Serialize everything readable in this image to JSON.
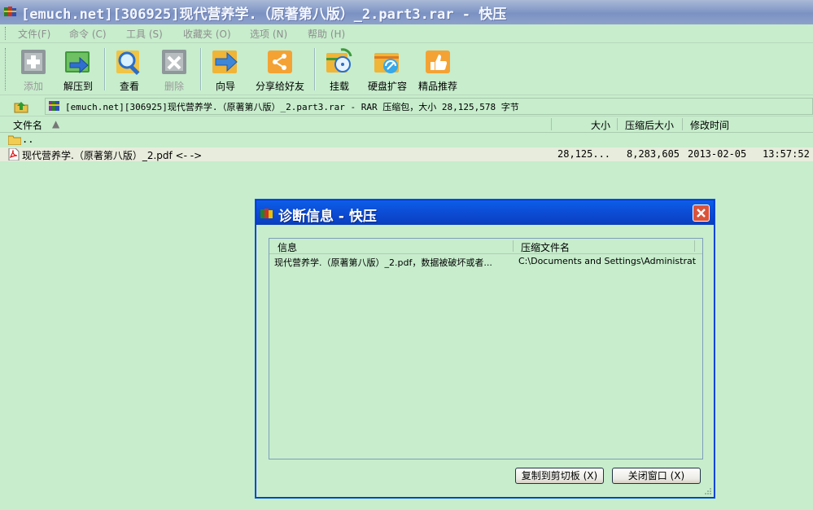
{
  "window": {
    "title": "[emuch.net][306925]现代营养学.（原著第八版）_2.part3.rar - 快压",
    "app_icon": "kuaiya-app-icon"
  },
  "menu": [
    "文件(F)",
    "命令 (C)",
    "工具 (S)",
    "收藏夹 (O)",
    "选项 (N)",
    "帮助 (H)"
  ],
  "toolbar": {
    "buttons": [
      {
        "label": "添加",
        "icon": "add-icon",
        "enabled": false
      },
      {
        "label": "解压到",
        "icon": "extract-icon",
        "enabled": true
      },
      {
        "label": "查看",
        "icon": "view-icon",
        "enabled": true
      },
      {
        "label": "删除",
        "icon": "delete-icon",
        "enabled": false
      },
      {
        "label": "向导",
        "icon": "wizard-icon",
        "enabled": true
      },
      {
        "label": "分享给好友",
        "icon": "share-icon",
        "enabled": true
      },
      {
        "label": "挂载",
        "icon": "mount-icon",
        "enabled": true
      },
      {
        "label": "硬盘扩容",
        "icon": "disk-expand-icon",
        "enabled": true
      },
      {
        "label": "精品推荐",
        "icon": "recommend-icon",
        "enabled": true
      }
    ]
  },
  "address": {
    "text": "[emuch.net][306925]现代营养学.（原著第八版）_2.part3.rar - RAR 压缩包，大小 28,125,578 字节"
  },
  "list": {
    "columns": [
      "文件名",
      "大小",
      "压缩后大小",
      "修改时间"
    ],
    "parent": "..",
    "rows": [
      {
        "name": "现代营养学.（原著第八版）_2.pdf <- ->",
        "size": "28,125...",
        "packed": "8,283,605",
        "date": "2013-02-05",
        "time": "13:57:52"
      }
    ]
  },
  "dialog": {
    "title": "诊断信息 - 快压",
    "columns": [
      "信息",
      "压缩文件名"
    ],
    "rows": [
      {
        "info": "现代营养学.（原著第八版）_2.pdf，数据被破坏或者...",
        "archive": "C:\\Documents and Settings\\Administrator..."
      }
    ],
    "copy_button": "复制到剪切板 (X)",
    "close_button": "关闭窗口 (X)"
  },
  "colors": {
    "background": "#c7edcc",
    "dialog_title": "#0a4fd8",
    "close_button": "#d9543a"
  }
}
